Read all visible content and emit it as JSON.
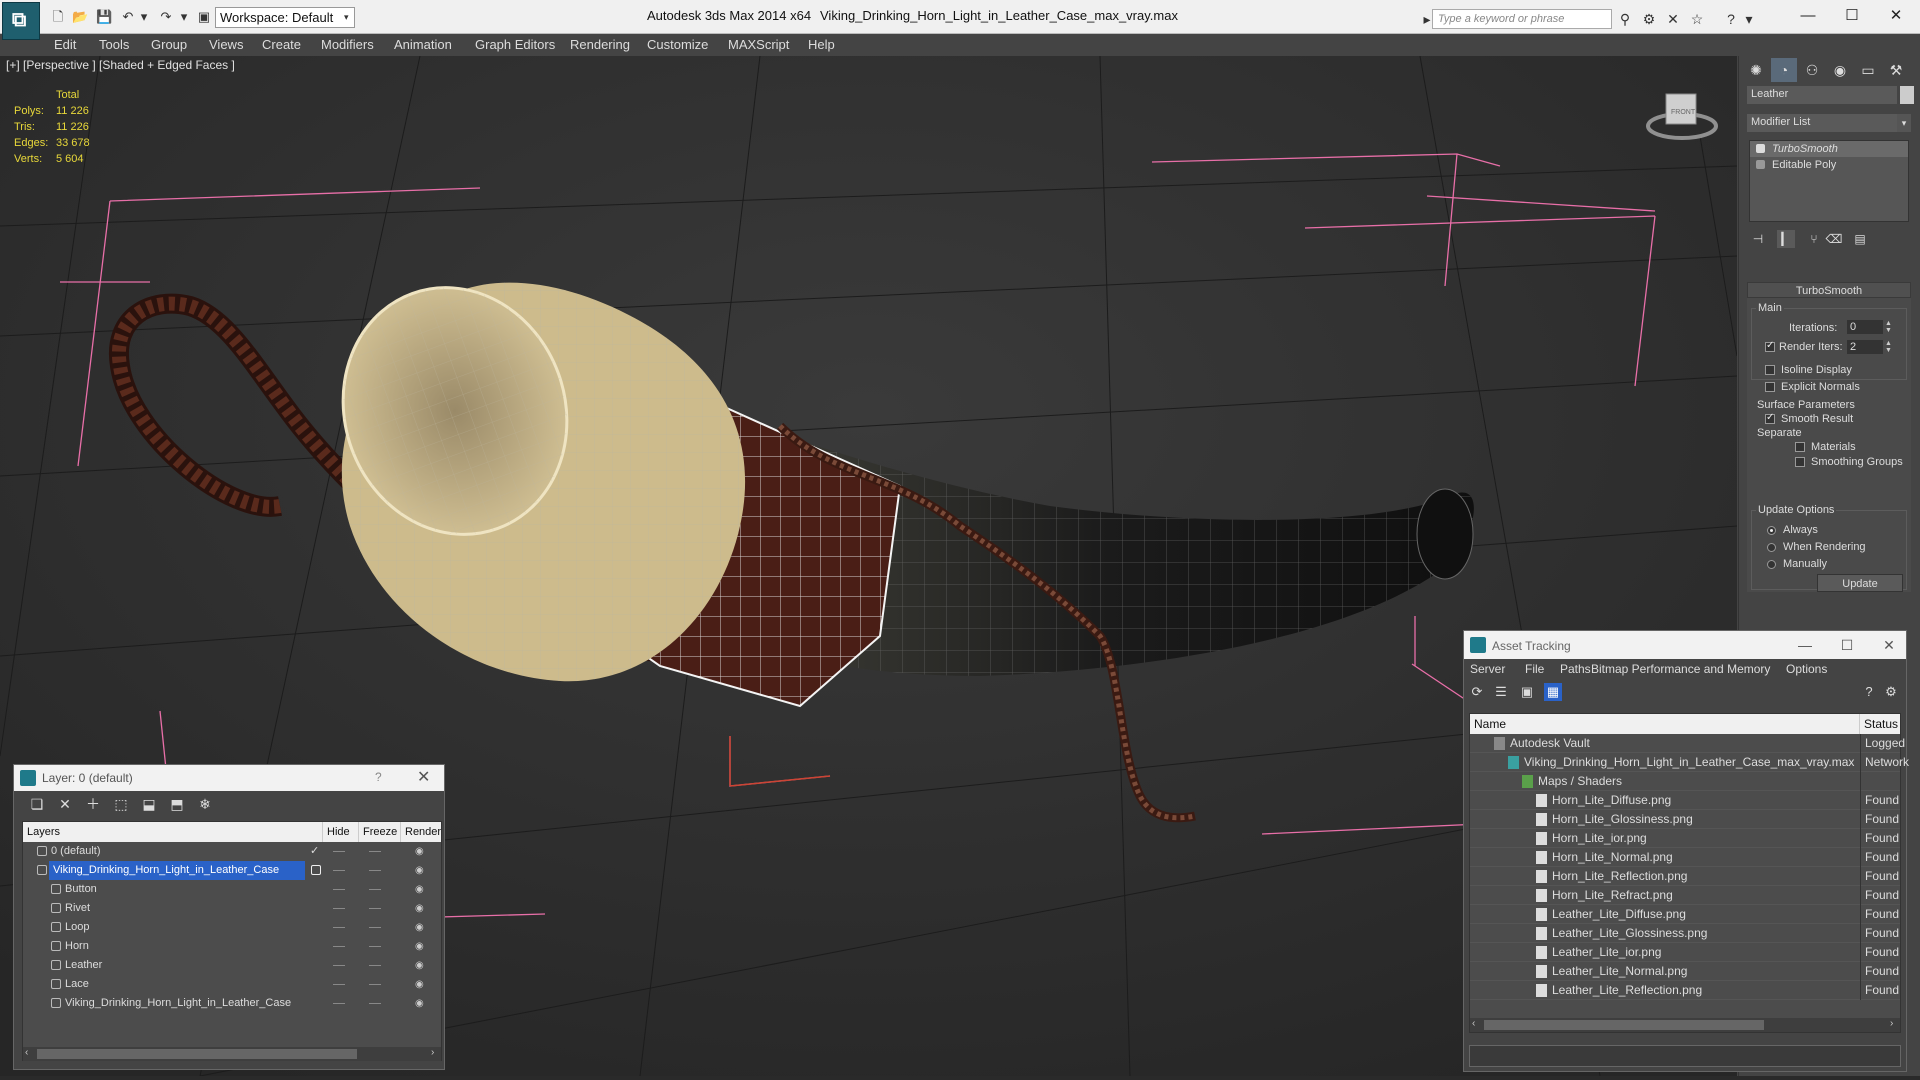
{
  "titlebar": {
    "workspace": "Workspace: Default",
    "app_title": "Autodesk 3ds Max  2014 x64",
    "file_title": "Viking_Drinking_Horn_Light_in_Leather_Case_max_vray.max",
    "search_placeholder": "Type a keyword or phrase"
  },
  "menu": [
    "Edit",
    "Tools",
    "Group",
    "Views",
    "Create",
    "Modifiers",
    "Animation",
    "Graph Editors",
    "Rendering",
    "Customize",
    "MAXScript",
    "Help"
  ],
  "viewport": {
    "label": "[+] [Perspective ] [Shaded + Edged Faces ]",
    "stats": {
      "header": "Total",
      "rows": [
        {
          "k": "Polys:",
          "v": "11 226"
        },
        {
          "k": "Tris:",
          "v": "11 226"
        },
        {
          "k": "Edges:",
          "v": "33 678"
        },
        {
          "k": "Verts:",
          "v": "5 604"
        }
      ]
    }
  },
  "command_panel": {
    "object_name": "Leather",
    "modifier_list": "Modifier List",
    "stack": [
      "TurboSmooth",
      "Editable Poly"
    ],
    "rollout_title": "TurboSmooth",
    "main_label": "Main",
    "iterations_label": "Iterations:",
    "iterations_value": "0",
    "render_iters_label": "Render Iters:",
    "render_iters_value": "2",
    "isoline": "Isoline Display",
    "explicit_normals": "Explicit Normals",
    "surface_params": "Surface Parameters",
    "smooth_result": "Smooth Result",
    "separate": "Separate",
    "materials": "Materials",
    "smoothing_groups": "Smoothing Groups",
    "update_options": "Update Options",
    "always": "Always",
    "when_rendering": "When Rendering",
    "manually": "Manually",
    "update_btn": "Update"
  },
  "layer_dialog": {
    "title": "Layer: 0 (default)",
    "help": "?",
    "columns": [
      "Layers",
      "Hide",
      "Freeze",
      "Render"
    ],
    "rows": [
      {
        "name": "0 (default)",
        "indent": 1,
        "selected": false
      },
      {
        "name": "Viking_Drinking_Horn_Light_in_Leather_Case",
        "indent": 1,
        "selected": true
      },
      {
        "name": "Button",
        "indent": 2,
        "selected": false
      },
      {
        "name": "Rivet",
        "indent": 2,
        "selected": false
      },
      {
        "name": "Loop",
        "indent": 2,
        "selected": false
      },
      {
        "name": "Horn",
        "indent": 2,
        "selected": false
      },
      {
        "name": "Leather",
        "indent": 2,
        "selected": false
      },
      {
        "name": "Lace",
        "indent": 2,
        "selected": false
      },
      {
        "name": "Viking_Drinking_Horn_Light_in_Leather_Case",
        "indent": 2,
        "selected": false
      }
    ]
  },
  "asset_dialog": {
    "title": "Asset Tracking",
    "menu": [
      "Server",
      "File",
      "Paths",
      "Bitmap Performance and Memory",
      "Options"
    ],
    "columns": [
      "Name",
      "Status"
    ],
    "rows": [
      {
        "name": "Autodesk Vault",
        "status": "Logged",
        "indent": 1
      },
      {
        "name": "Viking_Drinking_Horn_Light_in_Leather_Case_max_vray.max",
        "status": "Network",
        "indent": 2
      },
      {
        "name": "Maps / Shaders",
        "status": "",
        "indent": 3
      },
      {
        "name": "Horn_Lite_Diffuse.png",
        "status": "Found",
        "indent": 4
      },
      {
        "name": "Horn_Lite_Glossiness.png",
        "status": "Found",
        "indent": 4
      },
      {
        "name": "Horn_Lite_ior.png",
        "status": "Found",
        "indent": 4
      },
      {
        "name": "Horn_Lite_Normal.png",
        "status": "Found",
        "indent": 4
      },
      {
        "name": "Horn_Lite_Reflection.png",
        "status": "Found",
        "indent": 4
      },
      {
        "name": "Horn_Lite_Refract.png",
        "status": "Found",
        "indent": 4
      },
      {
        "name": "Leather_Lite_Diffuse.png",
        "status": "Found",
        "indent": 4
      },
      {
        "name": "Leather_Lite_Glossiness.png",
        "status": "Found",
        "indent": 4
      },
      {
        "name": "Leather_Lite_ior.png",
        "status": "Found",
        "indent": 4
      },
      {
        "name": "Leather_Lite_Normal.png",
        "status": "Found",
        "indent": 4
      },
      {
        "name": "Leather_Lite_Reflection.png",
        "status": "Found",
        "indent": 4
      }
    ]
  },
  "colors": {
    "stats": "#e8d83a",
    "selection": "#2a62c8",
    "bbox": "#e86fa8",
    "horn_inner": "#d9c89a",
    "leather": "#4a1e16"
  }
}
